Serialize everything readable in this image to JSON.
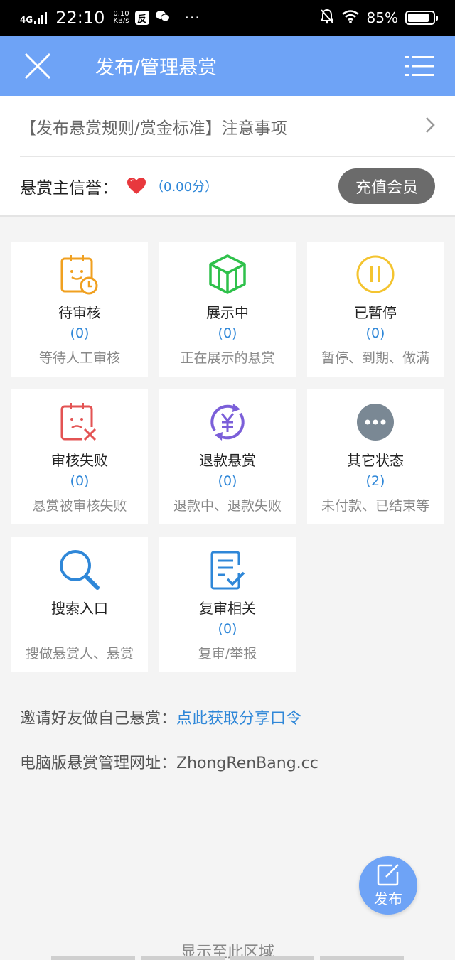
{
  "status_bar": {
    "network": "4G",
    "time": "22:10",
    "speed_value": "0.10",
    "speed_unit": "KB/s",
    "app1": "反",
    "dots": "···",
    "battery": "85%",
    "battery_level": 0.85
  },
  "header": {
    "title": "发布/管理悬赏"
  },
  "notice": {
    "text": "【发布悬赏规则/赏金标准】注意事项"
  },
  "credit": {
    "label": "悬赏主信誉：",
    "score": "（0.00分）",
    "recharge_label": "充值会员"
  },
  "cards": [
    {
      "title": "待审核",
      "count": "(0)",
      "desc": "等待人工审核",
      "icon": "pending-review-icon",
      "color": "#f0a020"
    },
    {
      "title": "展示中",
      "count": "(0)",
      "desc": "正在展示的悬赏",
      "icon": "cube-icon",
      "color": "#2fc14b"
    },
    {
      "title": "已暂停",
      "count": "(0)",
      "desc": "暂停、到期、做满",
      "icon": "pause-icon",
      "color": "#f4c430"
    },
    {
      "title": "审核失败",
      "count": "(0)",
      "desc": "悬赏被审核失败",
      "icon": "review-failed-icon",
      "color": "#e35353"
    },
    {
      "title": "退款悬赏",
      "count": "(0)",
      "desc": "退款中、退款失败",
      "icon": "refund-icon",
      "color": "#7b5fd9"
    },
    {
      "title": "其它状态",
      "count": "(2)",
      "desc": "未付款、已结束等",
      "icon": "more-icon",
      "color": "#7a8894"
    },
    {
      "title": "搜索入口",
      "count": "",
      "desc": "搜做悬赏人、悬赏",
      "icon": "search-icon",
      "color": "#2f87d8"
    },
    {
      "title": "复审相关",
      "count": "(0)",
      "desc": "复审/举报",
      "icon": "recheck-icon",
      "color": "#2f87d8"
    }
  ],
  "invite": {
    "label": "邀请好友做自己悬赏：",
    "link": "点此获取分享口令"
  },
  "pc": {
    "label": "电脑版悬赏管理网址：",
    "url": "ZhongRenBang.cc"
  },
  "fab": {
    "label": "发布"
  },
  "bottom_hint": "显示至此区域"
}
